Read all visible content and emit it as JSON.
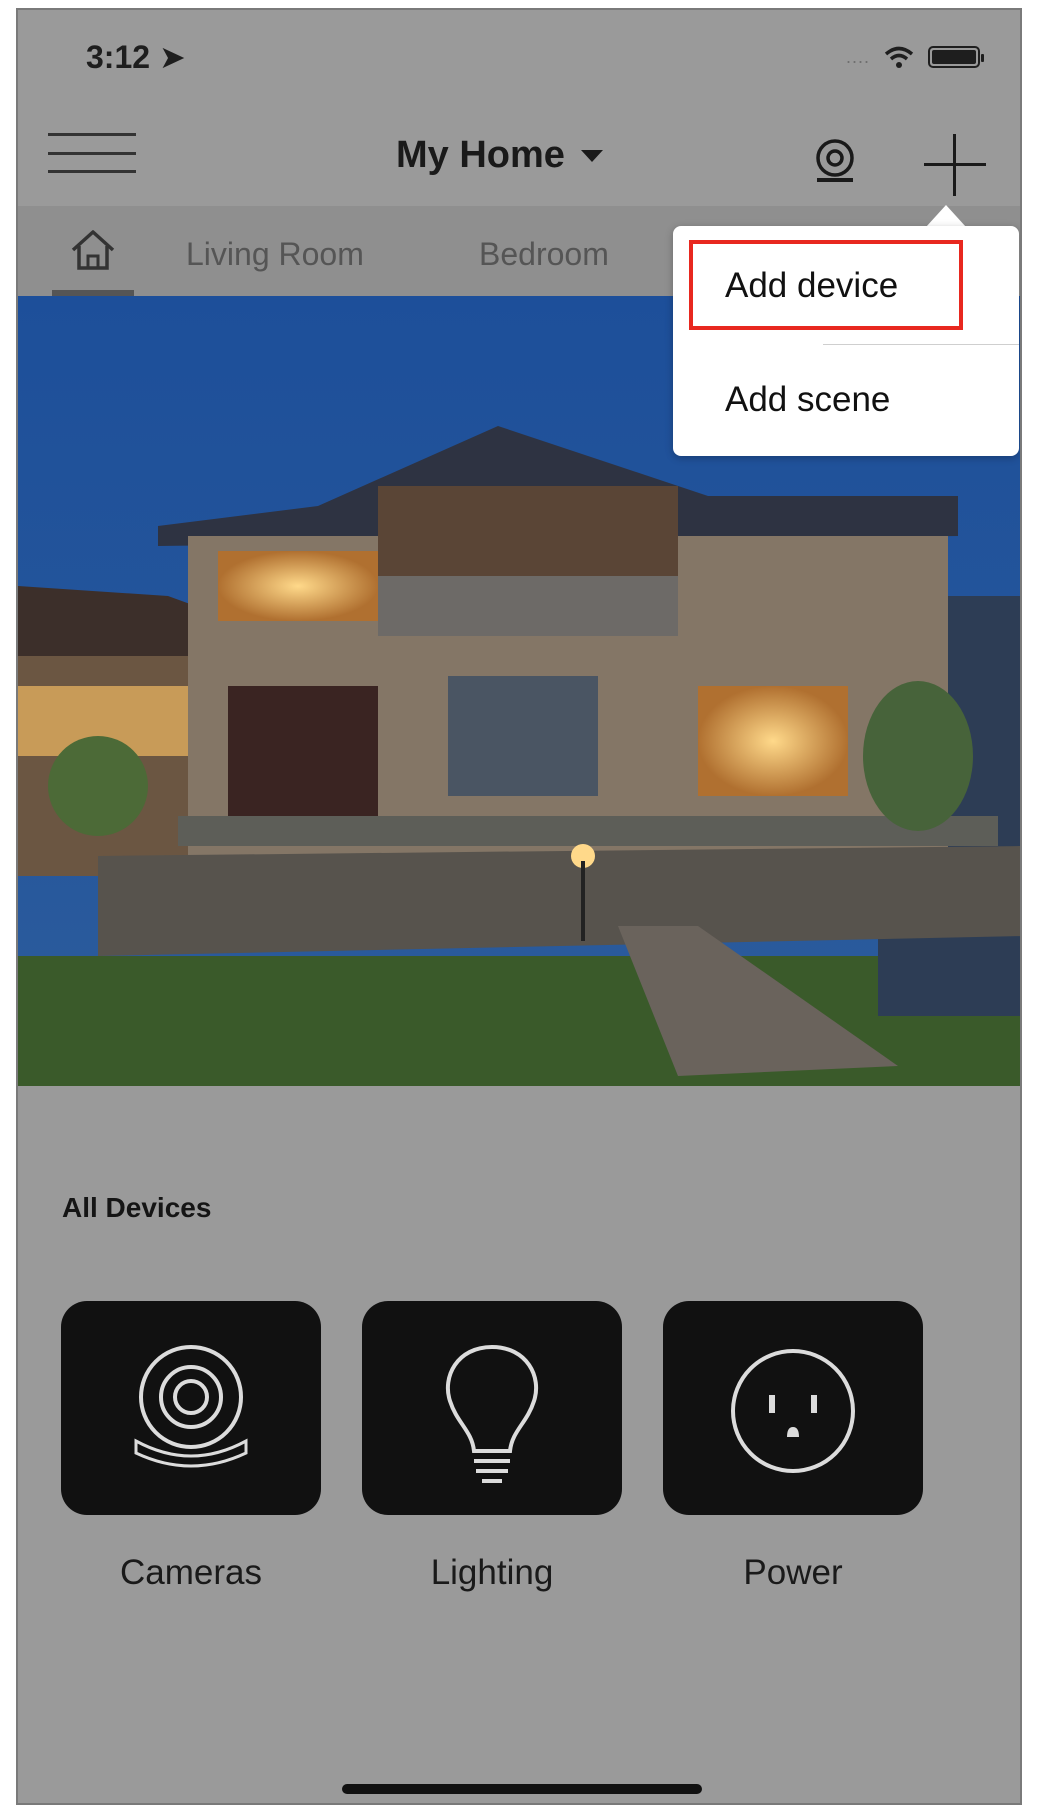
{
  "status_bar": {
    "time": "3:12 ➤",
    "signal": "....",
    "accent": "#1e1e1e"
  },
  "header": {
    "title": "My Home"
  },
  "tabs": {
    "items": [
      "Living Room",
      "Bedroom"
    ]
  },
  "menu": {
    "items": [
      {
        "label": "Add device",
        "highlighted": true
      },
      {
        "label": "Add scene",
        "highlighted": false
      }
    ],
    "highlight_color": "#e8281f"
  },
  "devices": {
    "section_title": "All Devices",
    "tiles": [
      {
        "label": "Cameras",
        "icon": "camera-icon"
      },
      {
        "label": "Lighting",
        "icon": "lightbulb-icon"
      },
      {
        "label": "Power",
        "icon": "power-outlet-icon"
      }
    ]
  },
  "icons": [
    "hamburger-menu-icon",
    "caret-down-icon",
    "camera-header-icon",
    "plus-icon",
    "home-icon",
    "wifi-icon",
    "battery-icon"
  ]
}
